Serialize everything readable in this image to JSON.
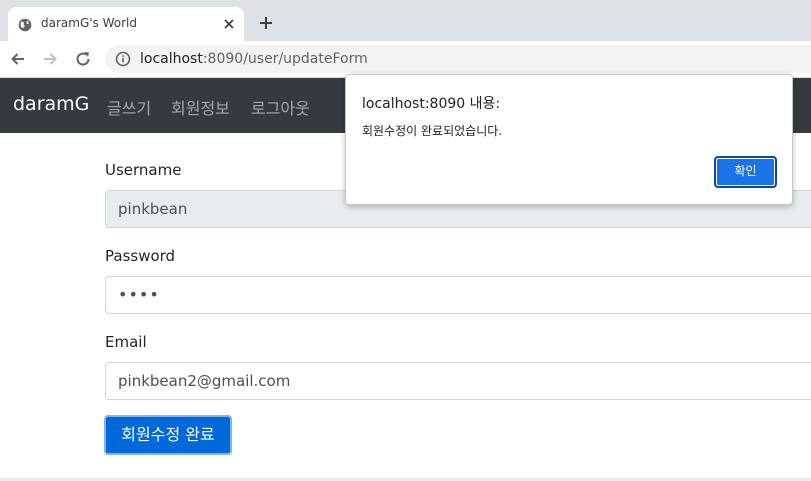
{
  "browser": {
    "tab_title": "daramG's World",
    "new_tab_icon": "plus-icon",
    "url_host": "localhost",
    "url_rest": ":8090/user/updateForm"
  },
  "navbar": {
    "brand": "daramG",
    "links": [
      "글쓰기",
      "회원정보",
      "로그아웃"
    ],
    "background": "#343a40"
  },
  "form": {
    "username_label": "Username",
    "username_value": "pinkbean",
    "password_label": "Password",
    "password_value": "••••",
    "email_label": "Email",
    "email_value": "pinkbean2@gmail.com",
    "submit_label": "회원수정 완료",
    "submit_color": "#0069d9"
  },
  "dialog": {
    "title": "localhost:8090 내용:",
    "message": "회원수정이 완료되었습니다.",
    "ok_label": "확인",
    "ok_color": "#1a73e8"
  }
}
